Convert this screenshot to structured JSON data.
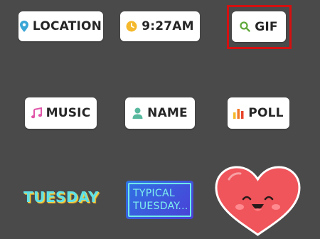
{
  "stickers": {
    "location": {
      "label": "LOCATION",
      "icon": "map-pin-icon",
      "color": "#3aa6d6"
    },
    "time": {
      "label": "9:27AM",
      "icon": "clock-icon",
      "color": "#f5b92d"
    },
    "gif": {
      "label": "GIF",
      "icon": "search-icon",
      "color": "#5fa83a",
      "highlighted": true,
      "highlight_color": "#d41010"
    },
    "music": {
      "label": "MUSIC",
      "icon": "music-note-icon",
      "color": "#e056a9"
    },
    "name": {
      "label": "NAME",
      "icon": "person-icon",
      "color": "#57b89e"
    },
    "poll": {
      "label": "POLL",
      "icon": "bar-chart-icon",
      "color": "#f07a2a"
    },
    "day": {
      "label": "TUESDAY",
      "color": "#5fe0e6"
    },
    "typical": {
      "line1": "TYPICAL",
      "line2": "TUESDAY..."
    },
    "heart": {
      "icon": "smiling-heart-icon",
      "color": "#f0555c"
    }
  },
  "background": "#4a4a4a"
}
